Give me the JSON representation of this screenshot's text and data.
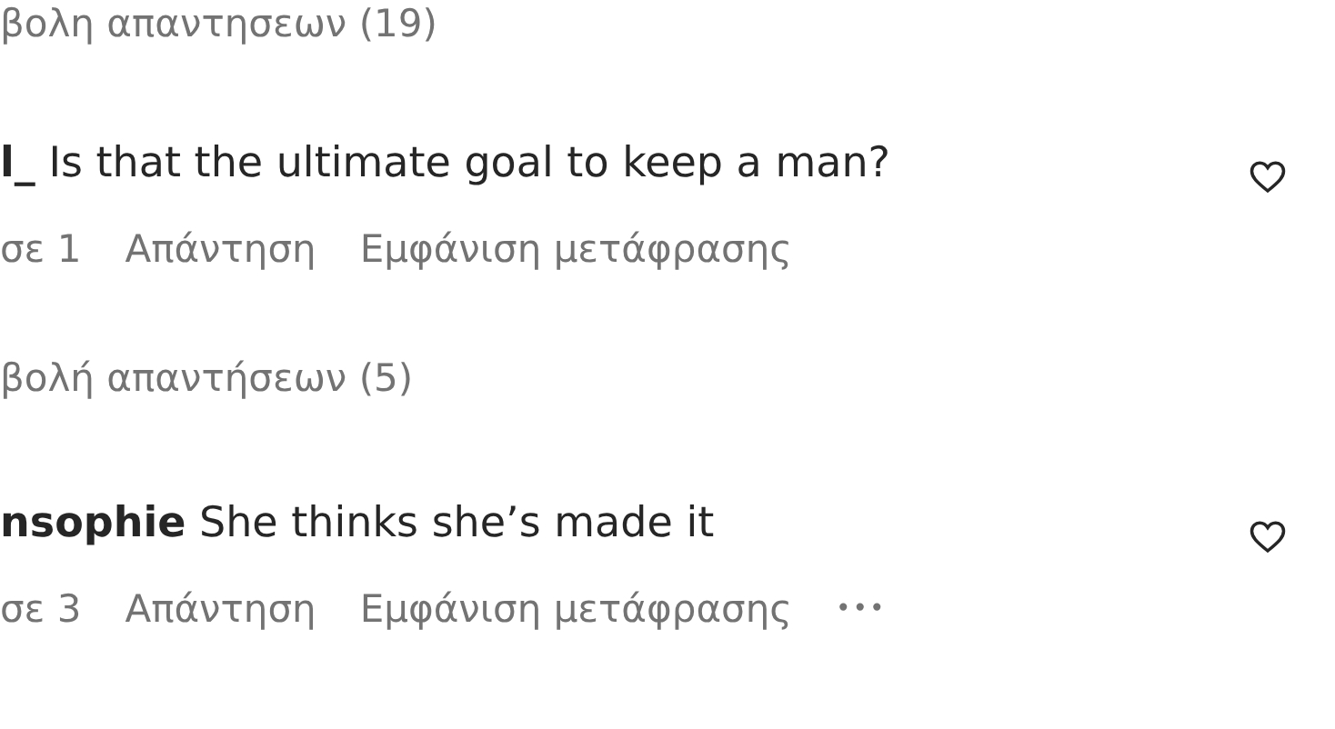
{
  "threads": [
    {
      "top_replies_toggle": "βολη απαντησεων (19)"
    },
    {
      "comment": {
        "username": "l_",
        "text": "Is that the ultimate goal to keep a man?",
        "likes": "σε 1",
        "reply": "Απάντηση",
        "translate": "Εμφάνιση μετάφρασης",
        "liked": false
      },
      "replies_toggle": "βολή απαντήσεων (5)"
    },
    {
      "comment": {
        "username": "nsophie",
        "text": "She thinks she’s made it",
        "likes": "σε 3",
        "reply": "Απάντηση",
        "translate": "Εμφάνιση μετάφρασης",
        "more": "•••",
        "liked": false
      }
    }
  ]
}
